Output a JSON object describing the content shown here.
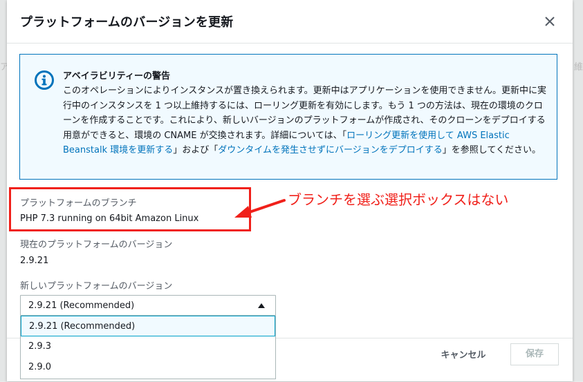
{
  "dialog": {
    "title": "プラットフォームのバージョンを更新"
  },
  "alert": {
    "title": "アベイラビリティーの警告",
    "body_part1": "このオペレーションによりインスタンスが置き換えられます。更新中はアプリケーションを使用できません。更新中に実行中のインスタンスを 1 つ以上維持するには、ローリング更新を有効にします。もう 1 つの方法は、現在の環境のクローンを作成することです。これにより、新しいバージョンのプラットフォームが作成され、そのクローンをデプロイする用意ができると、環境の CNAME が交換されます。詳細については、「",
    "link1": "ローリング更新を使用して AWS Elastic Beanstalk 環境を更新する",
    "body_part2": "」および「",
    "link2": "ダウンタイムを発生させずにバージョンをデプロイする",
    "body_part3": "」を参照してください。"
  },
  "branch": {
    "label": "プラットフォームのブランチ",
    "value": "PHP 7.3 running on 64bit Amazon Linux"
  },
  "annotation": {
    "text": "ブランチを選ぶ選択ボックスはない"
  },
  "current_version": {
    "label": "現在のプラットフォームのバージョン",
    "value": "2.9.21"
  },
  "new_version": {
    "label": "新しいプラットフォームのバージョン",
    "selected": "2.9.21 (Recommended)",
    "options": [
      "2.9.21 (Recommended)",
      "2.9.3",
      "2.9.0"
    ]
  },
  "footer": {
    "cancel_label": "キャンセル",
    "save_label": "保存"
  },
  "colors": {
    "link": "#0073bb",
    "alert_border": "#0073bb",
    "alert_bg": "#f1faff",
    "annotation_red": "#f0201a"
  }
}
